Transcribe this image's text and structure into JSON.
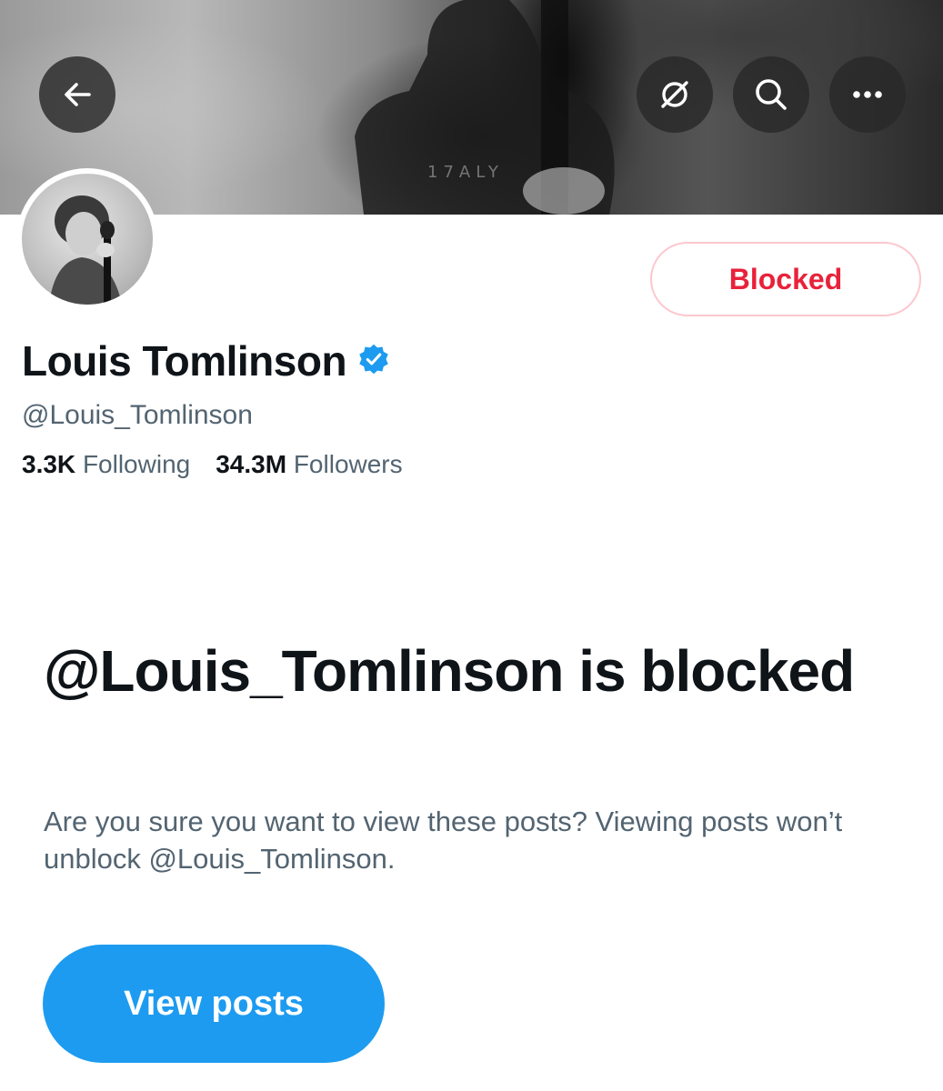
{
  "profile": {
    "display_name": "Louis Tomlinson",
    "handle": "@Louis_Tomlinson",
    "blocked_button_label": "Blocked",
    "stats": {
      "following_count": "3.3K",
      "following_label": "Following",
      "followers_count": "34.3M",
      "followers_label": "Followers"
    }
  },
  "blocked_notice": {
    "title": "@Louis_Tomlinson is blocked",
    "description": "Are you sure you want to view these posts? Viewing posts won’t unblock @Louis_Tomlinson.",
    "button_label": "View posts"
  },
  "icons": {
    "back": "arrow-left-icon",
    "grok": "slash-circle-icon",
    "search": "search-icon",
    "more": "more-horizontal-icon",
    "verified": "verified-badge-icon"
  },
  "colors": {
    "accent": "#1d9bf0",
    "blocked_red": "#e8223a",
    "blocked_border": "#fcc7ce",
    "secondary_text": "#536471",
    "verified_blue": "#1d9bf0"
  }
}
